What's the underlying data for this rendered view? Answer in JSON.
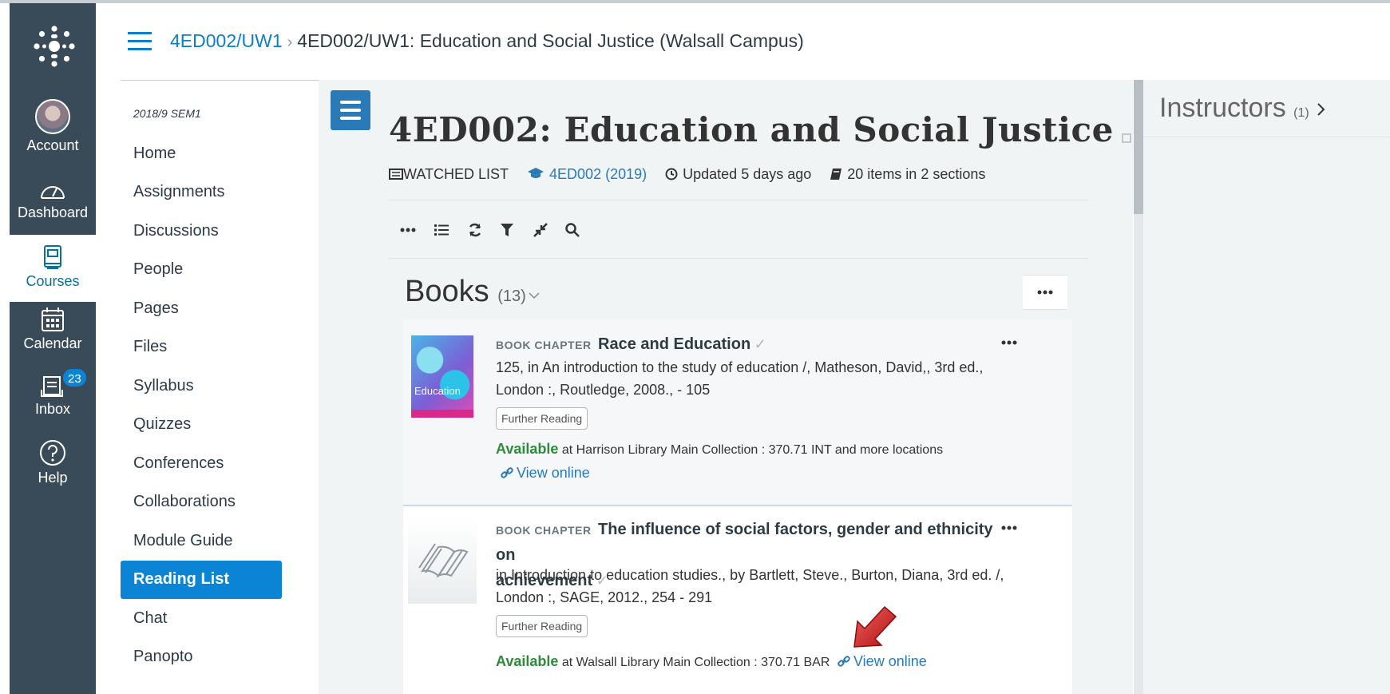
{
  "global_nav": {
    "account": "Account",
    "dashboard": "Dashboard",
    "courses": "Courses",
    "calendar": "Calendar",
    "inbox": "Inbox",
    "inbox_badge": "23",
    "help": "Help"
  },
  "breadcrumb": {
    "course_code": "4ED002/UW1",
    "separator": "›",
    "current": "4ED002/UW1: Education and Social Justice (Walsall Campus)"
  },
  "course_nav": {
    "term": "2018/9 SEM1",
    "items": [
      "Home",
      "Assignments",
      "Discussions",
      "People",
      "Pages",
      "Files",
      "Syllabus",
      "Quizzes",
      "Conferences",
      "Collaborations",
      "Module Guide",
      "Reading List",
      "Chat",
      "Panopto"
    ],
    "active": "Reading List"
  },
  "list": {
    "title": "4ED002: Education and Social Justice",
    "watched": "WATCHED LIST",
    "module": "4ED002 (2019)",
    "updated": "Updated 5 days ago",
    "items": "20 items in 2 sections"
  },
  "section": {
    "title": "Books",
    "count": "(13)"
  },
  "entries": [
    {
      "type": "BOOK CHAPTER",
      "title": "Race and Education",
      "cite_line1": "125, in An introduction to the study of education /, Matheson, David,, 3rd ed.,",
      "cite_line2": "London :, Routledge, 2008., - 105",
      "tag": "Further Reading",
      "available": "Available",
      "location": "at Harrison Library Main Collection : 370.71 INT and more locations",
      "view_online": "View online",
      "cover_text": "Education"
    },
    {
      "type": "BOOK CHAPTER",
      "title_line1": "The influence of social factors, gender and ethnicity on",
      "title_line2": "achievement",
      "cite_line1": "in Introduction to education studies., by Bartlett, Steve., Burton, Diana, 3rd ed. /,",
      "cite_line2": "London :, SAGE, 2012., 254 - 291",
      "tag": "Further Reading",
      "available": "Available",
      "location": "at Walsall Library Main Collection : 370.71 BAR",
      "view_online": "View online"
    }
  ],
  "right_panel": {
    "title": "Instructors",
    "count": "(1)"
  },
  "colors": {
    "nav_bg": "#394b58",
    "link": "#0b7fc7",
    "active_nav": "#0b84d6",
    "available": "#2e8b3a",
    "arrow": "#d42020"
  }
}
